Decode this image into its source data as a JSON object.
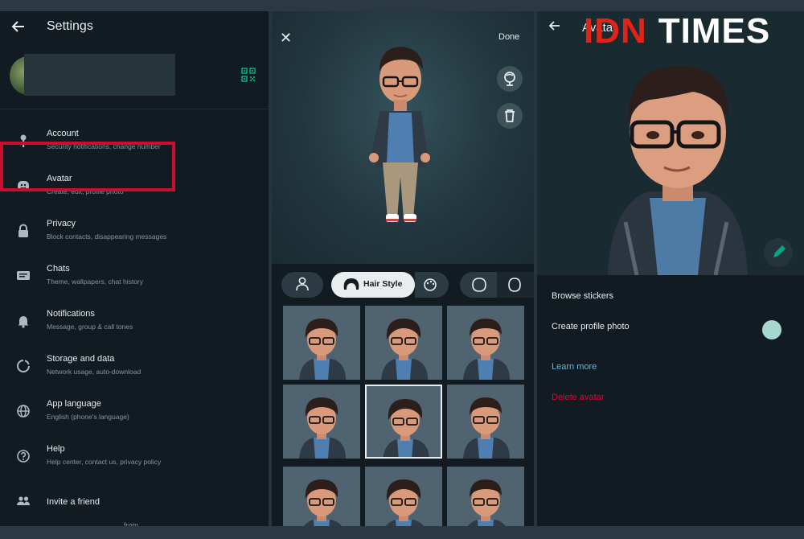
{
  "watermark": {
    "brand": "IDN",
    "word": "TIMES",
    "brand_color": "#e2231a"
  },
  "settings": {
    "title": "Settings",
    "items": [
      {
        "label": "Account",
        "sub": "Security notifications, change number",
        "icon": "key-icon"
      },
      {
        "label": "Avatar",
        "sub": "Create, edit, profile photo",
        "icon": "avatar-face-icon"
      },
      {
        "label": "Privacy",
        "sub": "Block contacts, disappearing messages",
        "icon": "lock-icon"
      },
      {
        "label": "Chats",
        "sub": "Theme, wallpapers, chat history",
        "icon": "chat-icon"
      },
      {
        "label": "Notifications",
        "sub": "Message, group & call tones",
        "icon": "bell-icon"
      },
      {
        "label": "Storage and data",
        "sub": "Network usage, auto-download",
        "icon": "storage-icon"
      },
      {
        "label": "App language",
        "sub": "English (phone's language)",
        "icon": "globe-icon"
      },
      {
        "label": "Help",
        "sub": "Help center, contact us, privacy policy",
        "icon": "help-icon"
      },
      {
        "label": "Invite a friend",
        "sub": "",
        "icon": "people-icon"
      }
    ],
    "footer": "from",
    "accent": "#00a884"
  },
  "editor": {
    "close": "✕",
    "done": "Done",
    "tabs": {
      "active": "Hair Style"
    }
  },
  "avatar_page": {
    "title": "Avatar",
    "browse": "Browse stickers",
    "create_photo": "Create profile photo",
    "learn_more": "Learn more",
    "delete": "Delete avatar",
    "toggle_color": "#a7d8d0"
  }
}
